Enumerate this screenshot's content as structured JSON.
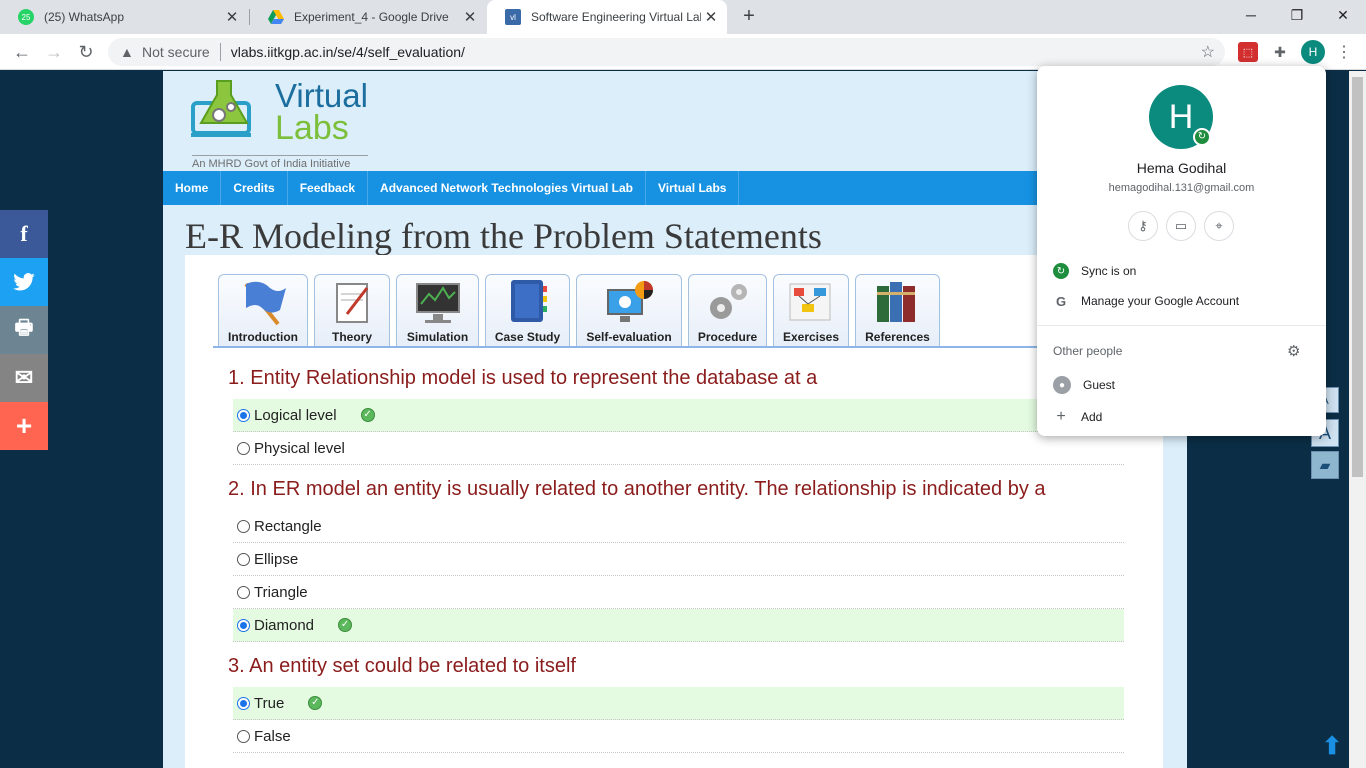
{
  "browser": {
    "tabs": [
      {
        "title": "(25) WhatsApp",
        "favicon": "whatsapp-icon",
        "badge": "25"
      },
      {
        "title": "Experiment_4 - Google Drive",
        "favicon": "google-drive-icon"
      },
      {
        "title": "Software Engineering Virtual Lab",
        "favicon": "vlabs-icon"
      }
    ],
    "new_tab": "+",
    "security_label": "Not secure",
    "url": "vlabs.iitkgp.ac.in/se/4/self_evaluation/",
    "profile_initial": "H"
  },
  "site": {
    "logo": {
      "word1": "Virtual",
      "word2": "Labs",
      "tagline": "An MHRD Govt of India Initiative"
    },
    "nav": [
      "Home",
      "Credits",
      "Feedback",
      "Advanced Network Technologies Virtual Lab",
      "Virtual Labs"
    ],
    "page_title": "E-R Modeling from the Problem Statements",
    "lab_tabs": [
      "Introduction",
      "Theory",
      "Simulation",
      "Case Study",
      "Self-evaluation",
      "Procedure",
      "Exercises",
      "References"
    ]
  },
  "quiz": {
    "q1": {
      "text": "1. Entity Relationship model is used to represent the database at a",
      "options": [
        "Logical level",
        "Physical level"
      ]
    },
    "q2": {
      "text": "2. In ER model an entity is usually related to another entity. The relationship is indicated by a",
      "options": [
        "Rectangle",
        "Ellipse",
        "Triangle",
        "Diamond"
      ]
    },
    "q3": {
      "text": "3. An entity set could be related to itself",
      "options": [
        "True",
        "False"
      ]
    }
  },
  "share": [
    {
      "name": "facebook",
      "glyph": "f",
      "color": "#3b5998"
    },
    {
      "name": "twitter",
      "glyph": "🐦",
      "color": "#1da1f2"
    },
    {
      "name": "print",
      "glyph": "🖶",
      "color": "#6d8592"
    },
    {
      "name": "email",
      "glyph": "✉",
      "color": "#848484"
    },
    {
      "name": "more",
      "glyph": "+",
      "color": "#ff6550"
    }
  ],
  "profile": {
    "initial": "H",
    "name": "Hema Godihal",
    "email": "hemagodihal.131@gmail.com",
    "sync": "Sync is on",
    "manage": "Manage your Google Account",
    "other_people": "Other people",
    "guest": "Guest",
    "add": "Add"
  },
  "colors": {
    "site_nav": "#1792e3",
    "question": "#8b1c1c",
    "correct_row": "#e4fbe1",
    "avatar": "#0b8a7e"
  }
}
